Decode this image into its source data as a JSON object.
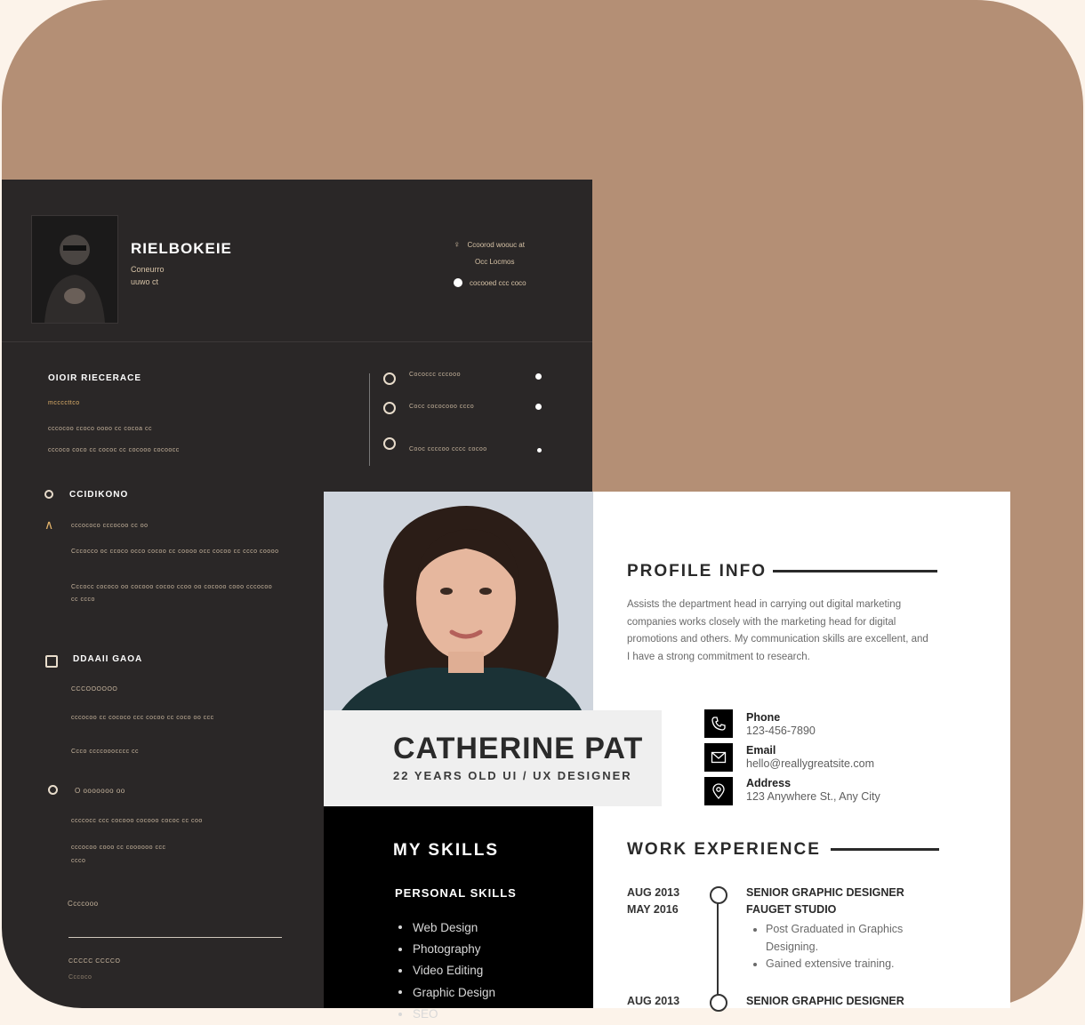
{
  "dark_resume": {
    "name": "RIELBOKEIE",
    "subtitle_1": "Coneurro",
    "subtitle_2": "uuwo ct",
    "contacts": [
      "Ccoorod woouc at",
      "Occ Locmos",
      "cocooed ccc coco"
    ],
    "section_1_title": "OIOIR RIECERACE",
    "section_1_sub": "mccccttco",
    "section_1_lines": [
      "cccocoo ccoco oooo cc cocoa cc",
      "cccoco coco cc cococ cc cocooo cocoocc"
    ],
    "side_items": [
      "Cococcc cccooo",
      "Cocc cococooo ccco",
      "Cooc ccccoo cccc cocoo"
    ],
    "experience_title": "CCIDIKONO",
    "experience_item": "cccococo cccocoo cc oo",
    "experience_paras": [
      "Cccocco oc ccoco occo cocoo cc coooo occ cocoo cc ccco coooo",
      "Cccocc cococo oo cocooo cocoo ccoo oo cocooo cooo cccocoo cc ccco"
    ],
    "section_3_title": "DDAAII GAOA",
    "section_3_sub": "CCCOOOOOO",
    "section_3_lines": [
      "cccocoo cc cococo ccc cocoo cc coco oo ccc",
      "Ccco ccccooocccc cc"
    ],
    "section_4_title": "O ooooooo oo",
    "section_4_lines": [
      "ccccocc ccc cocooo cocooo cococ cc coo",
      "cccocoo cooo cc coooooo ccc",
      "ccco"
    ],
    "section_4_footer": "Ccccooo",
    "footer_title": "CCCCC CCCCO",
    "footer_sub": "Cccoco"
  },
  "light_resume": {
    "name": "CATHERINE PAT",
    "role": "22 YEARS OLD UI / UX DESIGNER",
    "profile_title": "PROFILE INFO",
    "profile_text": "Assists the department head in carrying out digital marketing companies works closely with the marketing head for digital promotions and others. My communication skills are excellent, and I have a strong commitment to research.",
    "contacts": [
      {
        "label": "Phone",
        "value": "123-456-7890",
        "icon": "phone-icon"
      },
      {
        "label": "Email",
        "value": "hello@reallygreatsite.com",
        "icon": "mail-icon"
      },
      {
        "label": "Address",
        "value": "123 Anywhere St., Any City",
        "icon": "location-pin-icon"
      }
    ],
    "skills_title": "MY SKILLS",
    "skills_subtitle": "PERSONAL SKILLS",
    "skills": [
      "Web Design",
      "Photography",
      "Video Editing",
      "Graphic Design",
      "SEO"
    ],
    "work_title": "WORK EXPERIENCE",
    "jobs": [
      {
        "date_start": "AUG 2013",
        "date_end": "MAY 2016",
        "title": "SENIOR GRAPHIC DESIGNER",
        "company": "FAUGET STUDIO",
        "bullets": [
          "Post Graduated in Graphics Designing.",
          "Gained extensive training."
        ]
      },
      {
        "date_start": "AUG 2013",
        "title": "SENIOR GRAPHIC DESIGNER"
      }
    ]
  },
  "colors": {
    "background_card": "#b48f75",
    "page_background": "#fcf3ea",
    "dark_resume_bg": "#2a2727",
    "gold_text": "#c5b39c"
  }
}
